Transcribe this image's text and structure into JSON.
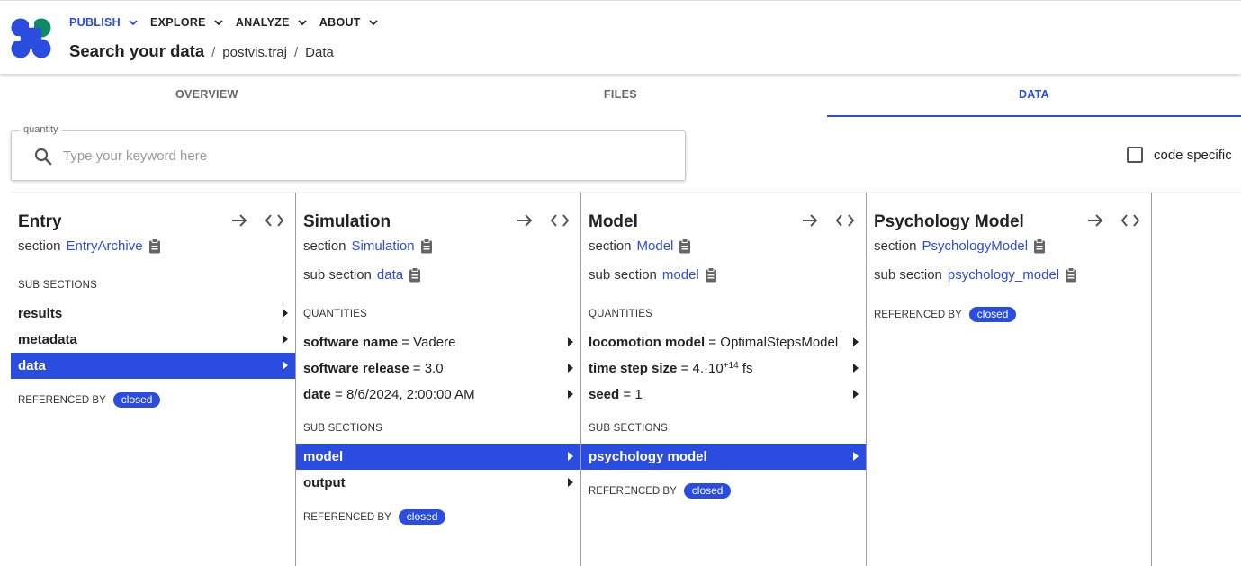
{
  "nav": {
    "items": [
      {
        "label": "PUBLISH",
        "active": true
      },
      {
        "label": "EXPLORE"
      },
      {
        "label": "ANALYZE"
      },
      {
        "label": "ABOUT"
      }
    ]
  },
  "breadcrumb": {
    "title": "Search your data",
    "sep": "/",
    "items": [
      "postvis.traj",
      "Data"
    ]
  },
  "tabs": [
    "OVERVIEW",
    "FILES",
    "DATA"
  ],
  "search": {
    "legend": "quantity",
    "placeholder": "Type your keyword here"
  },
  "code_specific": {
    "label": "code specific",
    "checked": false
  },
  "columns": [
    {
      "title": "Entry",
      "section_label": "section",
      "section_link": "EntryArchive",
      "group1": "SUB SECTIONS",
      "rows": [
        "results",
        "metadata",
        "data"
      ],
      "referenced_by": "REFERENCED BY",
      "badge": "closed"
    },
    {
      "title": "Simulation",
      "section_label": "section",
      "section_link": "Simulation",
      "sub_section_label": "sub section",
      "sub_section_link": "data",
      "group1": "QUANTITIES",
      "quantities": [
        {
          "name": "software name",
          "eq": " = ",
          "value": "Vadere"
        },
        {
          "name": "software release",
          "eq": " = ",
          "value": "3.0"
        },
        {
          "name": "date",
          "eq": " = ",
          "value": "8/6/2024, 2:00:00 AM"
        }
      ],
      "group2": "SUB SECTIONS",
      "rows": [
        "model",
        "output"
      ],
      "referenced_by": "REFERENCED BY",
      "badge": "closed"
    },
    {
      "title": "Model",
      "section_label": "section",
      "section_link": "Model",
      "sub_section_label": "sub section",
      "sub_section_link": "model",
      "group1": "QUANTITIES",
      "quantities": [
        {
          "name": "locomotion model",
          "eq": " = ",
          "value": "OptimalStepsModel"
        },
        {
          "name": "time step size",
          "eq": " = ",
          "value": "4.·10",
          "sup": "+14",
          "unit": " fs"
        },
        {
          "name": "seed",
          "eq": " = ",
          "value": "1"
        }
      ],
      "group2": "SUB SECTIONS",
      "rows": [
        "psychology model"
      ],
      "referenced_by": "REFERENCED BY",
      "badge": "closed"
    },
    {
      "title": "Psychology Model",
      "section_label": "section",
      "section_link": "PsychologyModel",
      "sub_section_label": "sub section",
      "sub_section_link": "psychology_model",
      "referenced_by": "REFERENCED BY",
      "badge": "closed"
    }
  ],
  "colors": {
    "accent": "#2a4cdf",
    "logo_blue": "#2a4cdf",
    "logo_green": "#0f8a64"
  },
  "icons": [
    "logo-icon",
    "chevron-down-icon",
    "search-icon",
    "arrow-right-icon",
    "code-icon",
    "clipboard-icon",
    "triangle-right-icon"
  ]
}
